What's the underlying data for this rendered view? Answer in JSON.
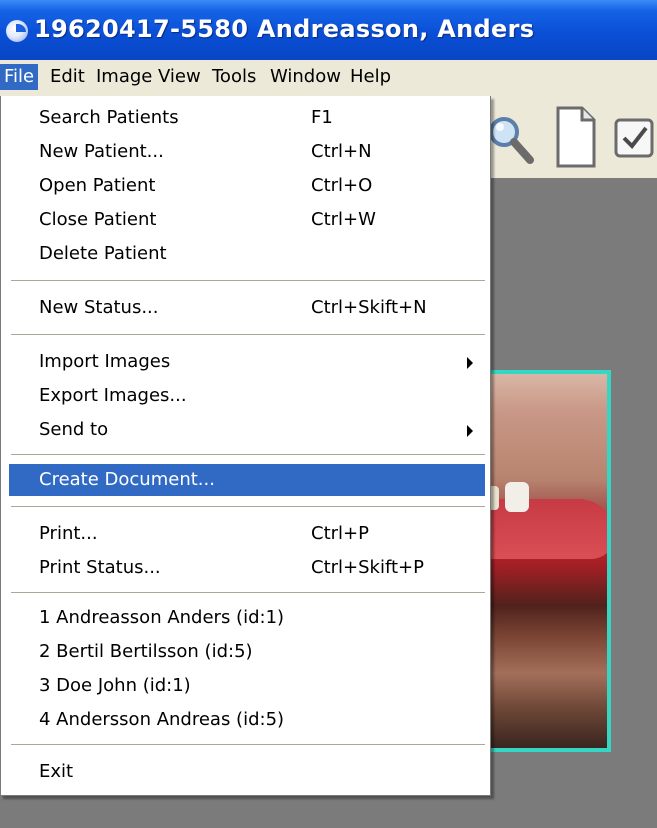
{
  "window": {
    "title": "19620417-5580 Andreasson, Anders"
  },
  "menubar": {
    "items": [
      {
        "label": "File",
        "active": true
      },
      {
        "label": "Edit"
      },
      {
        "label": "Image"
      },
      {
        "label": "View"
      },
      {
        "label": "Tools"
      },
      {
        "label": "Window"
      },
      {
        "label": "Help"
      }
    ]
  },
  "toolbar": {
    "icons": [
      "magnifier-icon",
      "new-document-icon",
      "checkbox-icon"
    ]
  },
  "file_menu": {
    "items": [
      {
        "label": "Search Patients",
        "shortcut": "F1"
      },
      {
        "label": "New Patient...",
        "shortcut": "Ctrl+N"
      },
      {
        "label": "Open Patient",
        "shortcut": "Ctrl+O"
      },
      {
        "label": "Close Patient",
        "shortcut": "Ctrl+W"
      },
      {
        "label": "Delete Patient",
        "shortcut": ""
      },
      {
        "label": "New Status...",
        "shortcut": "Ctrl+Skift+N"
      },
      {
        "label": "Import Images",
        "shortcut": "",
        "submenu": true
      },
      {
        "label": "Export Images...",
        "shortcut": ""
      },
      {
        "label": "Send to",
        "shortcut": "",
        "submenu": true
      },
      {
        "label": "Create Document...",
        "shortcut": "",
        "highlighted": true
      },
      {
        "label": "Print...",
        "shortcut": "Ctrl+P"
      },
      {
        "label": "Print Status...",
        "shortcut": "Ctrl+Skift+P"
      },
      {
        "label": "1  Andreasson Anders (id:1)",
        "shortcut": ""
      },
      {
        "label": "2  Bertil Bertilsson (id:5)",
        "shortcut": ""
      },
      {
        "label": "3  Doe John (id:1)",
        "shortcut": ""
      },
      {
        "label": "4  Andersson Andreas (id:5)",
        "shortcut": ""
      },
      {
        "label": "Exit",
        "shortcut": ""
      }
    ]
  },
  "colors": {
    "title_bar": "#0a4fd6",
    "highlight": "#316ac5",
    "image_border": "#35d6c3",
    "workspace": "#7b7b7b"
  }
}
